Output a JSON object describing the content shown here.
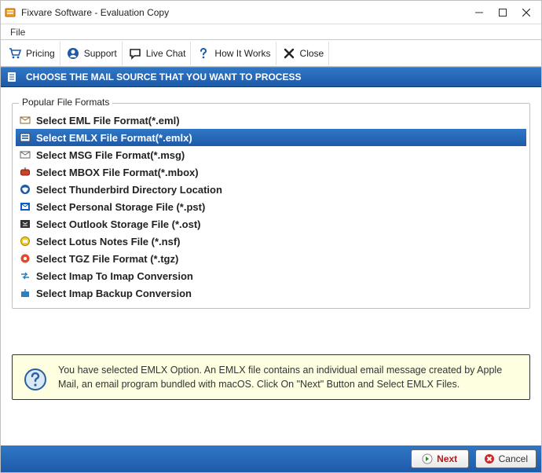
{
  "window": {
    "title": "Fixvare Software - Evaluation Copy"
  },
  "menu": {
    "file": "File"
  },
  "toolbar": {
    "pricing": "Pricing",
    "support": "Support",
    "livechat": "Live Chat",
    "howitworks": "How It Works",
    "close": "Close"
  },
  "banner": {
    "text": "CHOOSE THE MAIL SOURCE THAT YOU WANT TO PROCESS"
  },
  "group": {
    "legend": "Popular File Formats"
  },
  "formats": {
    "f0": "Select EML File Format(*.eml)",
    "f1": "Select EMLX File Format(*.emlx)",
    "f2": "Select MSG File Format(*.msg)",
    "f3": "Select MBOX File Format(*.mbox)",
    "f4": "Select Thunderbird Directory Location",
    "f5": "Select Personal Storage File (*.pst)",
    "f6": "Select Outlook Storage File (*.ost)",
    "f7": "Select Lotus Notes File (*.nsf)",
    "f8": "Select TGZ File Format (*.tgz)",
    "f9": "Select Imap To Imap Conversion",
    "f10": "Select Imap Backup Conversion"
  },
  "description": {
    "text": "You have selected EMLX Option. An EMLX file contains an individual email message created by Apple Mail, an email program bundled with macOS. Click On \"Next\" Button and Select EMLX Files."
  },
  "footer": {
    "next": "Next",
    "cancel": "Cancel"
  }
}
